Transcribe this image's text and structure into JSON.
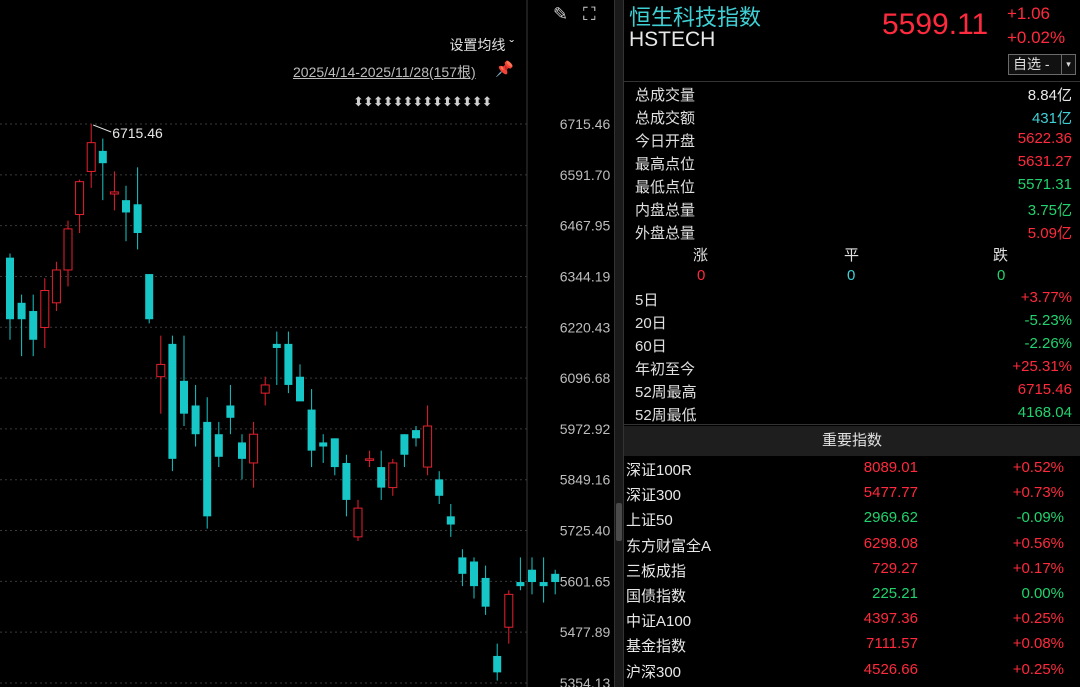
{
  "toolbar": {
    "draw_icon": "pencil-icon",
    "fullscreen_icon": "expand-icon"
  },
  "chart_header": {
    "ma_setting": "设置均线 ˇ",
    "range": "2025/4/14-2025/11/28(157根)",
    "pin_icon": "pin-icon",
    "arrows": "⬍⬍⬍⬍⬍⬍⬍⬍⬍⬍⬍⬍⬍⬍"
  },
  "chart_data": {
    "type": "candlestick",
    "y_ticks": [
      "6715.46",
      "6591.70",
      "6467.95",
      "6344.19",
      "6220.43",
      "6096.68",
      "5972.92",
      "5849.16",
      "5725.40",
      "5601.65",
      "5477.89",
      "5354.13"
    ],
    "ylim": [
      5354.13,
      6715.46
    ],
    "high_label": "6715.46",
    "up_color": "#e8202f",
    "down_color": "#17c6c6",
    "candles": [
      [
        6390,
        6240,
        6400,
        6190
      ],
      [
        6280,
        6240,
        6300,
        6150
      ],
      [
        6260,
        6190,
        6300,
        6150
      ],
      [
        6220,
        6310,
        6340,
        6170
      ],
      [
        6280,
        6360,
        6380,
        6260
      ],
      [
        6360,
        6460,
        6480,
        6320
      ],
      [
        6495,
        6575,
        6580,
        6450
      ],
      [
        6600,
        6670,
        6715,
        6560
      ],
      [
        6650,
        6620,
        6680,
        6530
      ],
      [
        6545,
        6550,
        6600,
        6505
      ],
      [
        6530,
        6500,
        6565,
        6430
      ],
      [
        6520,
        6450,
        6610,
        6410
      ],
      [
        6350,
        6240,
        6350,
        6230
      ],
      [
        6100,
        6130,
        6200,
        6010
      ],
      [
        6180,
        5900,
        6200,
        5870
      ],
      [
        6090,
        6010,
        6200,
        5980
      ],
      [
        6030,
        5960,
        6080,
        5930
      ],
      [
        5990,
        5760,
        6050,
        5730
      ],
      [
        5960,
        5905,
        5990,
        5880
      ],
      [
        6030,
        6000,
        6080,
        5960
      ],
      [
        5940,
        5900,
        5960,
        5850
      ],
      [
        5890,
        5960,
        5990,
        5830
      ],
      [
        6060,
        6080,
        6100,
        6030
      ],
      [
        6180,
        6170,
        6210,
        6080
      ],
      [
        6180,
        6080,
        6210,
        6060
      ],
      [
        6100,
        6040,
        6130,
        6060
      ],
      [
        6020,
        5920,
        6070,
        5880
      ],
      [
        5940,
        5930,
        5960,
        5890
      ],
      [
        5950,
        5880,
        5950,
        5860
      ],
      [
        5890,
        5800,
        5910,
        5760
      ],
      [
        5710,
        5780,
        5800,
        5700
      ],
      [
        5900,
        5900,
        5920,
        5880
      ],
      [
        5880,
        5830,
        5920,
        5800
      ],
      [
        5830,
        5890,
        5900,
        5810
      ],
      [
        5960,
        5910,
        5960,
        5880
      ],
      [
        5970,
        5950,
        5980,
        5930
      ],
      [
        5880,
        5980,
        6030,
        5860
      ],
      [
        5850,
        5810,
        5870,
        5790
      ],
      [
        5760,
        5740,
        5790,
        5710
      ],
      [
        5660,
        5620,
        5680,
        5590
      ],
      [
        5650,
        5590,
        5660,
        5560
      ],
      [
        5610,
        5540,
        5640,
        5520
      ],
      [
        5420,
        5380,
        5450,
        5360
      ],
      [
        5490,
        5570,
        5580,
        5450
      ],
      [
        5600,
        5590,
        5660,
        5580
      ],
      [
        5630,
        5600,
        5660,
        5570
      ],
      [
        5600,
        5590,
        5660,
        5550
      ],
      [
        5620,
        5600,
        5630,
        5570
      ]
    ]
  },
  "quote": {
    "name": "恒生科技指数",
    "code": "HSTECH",
    "price": "5599.11",
    "change": "+1.06",
    "change_pct": "+0.02%",
    "select_label": "自选 -",
    "select_arrow": "▾"
  },
  "stats_top": [
    {
      "label": "总成交量",
      "value": "8.84亿",
      "color": "#e8e8e8"
    },
    {
      "label": "总成交额",
      "value": "431亿",
      "color": "#3fd0d6"
    },
    {
      "label": "今日开盘",
      "value": "5622.36",
      "color": "#ff2a3d"
    },
    {
      "label": "最高点位",
      "value": "5631.27",
      "color": "#ff2a3d"
    },
    {
      "label": "最低点位",
      "value": "5571.31",
      "color": "#21d36e"
    },
    {
      "label": "内盘总量",
      "value": "3.75亿",
      "color": "#21d36e"
    },
    {
      "label": "外盘总量",
      "value": "5.09亿",
      "color": "#ff2a3d"
    }
  ],
  "breadth": {
    "up_label": "涨",
    "flat_label": "平",
    "down_label": "跌",
    "up_value": "0",
    "flat_value": "0",
    "down_value": "0"
  },
  "stats_bottom": [
    {
      "label": "5日",
      "value": "+3.77%",
      "color": "#ff2a3d"
    },
    {
      "label": "20日",
      "value": "-5.23%",
      "color": "#21d36e"
    },
    {
      "label": "60日",
      "value": "-2.26%",
      "color": "#21d36e"
    },
    {
      "label": "年初至今",
      "value": "+25.31%",
      "color": "#ff2a3d"
    },
    {
      "label": "52周最高",
      "value": "6715.46",
      "color": "#ff2a3d"
    },
    {
      "label": "52周最低",
      "value": "4168.04",
      "color": "#21d36e"
    }
  ],
  "important_header": "重要指数",
  "important_indices": [
    {
      "name": "深证100R",
      "value": "8089.01",
      "pct": "+0.52%",
      "color": "#ff2a3d"
    },
    {
      "name": "深证300",
      "value": "5477.77",
      "pct": "+0.73%",
      "color": "#ff2a3d"
    },
    {
      "name": "上证50",
      "value": "2969.62",
      "pct": "-0.09%",
      "color": "#21d36e"
    },
    {
      "name": "东方财富全A",
      "value": "6298.08",
      "pct": "+0.56%",
      "color": "#ff2a3d"
    },
    {
      "name": "三板成指",
      "value": "729.27",
      "pct": "+0.17%",
      "color": "#ff2a3d"
    },
    {
      "name": "国债指数",
      "value": "225.21",
      "pct": "0.00%",
      "color": "#21d36e"
    },
    {
      "name": "中证A100",
      "value": "4397.36",
      "pct": "+0.25%",
      "color": "#ff2a3d"
    },
    {
      "name": "基金指数",
      "value": "7111.57",
      "pct": "+0.08%",
      "color": "#ff2a3d"
    },
    {
      "name": "沪深300",
      "value": "4526.66",
      "pct": "+0.25%",
      "color": "#ff2a3d"
    }
  ]
}
